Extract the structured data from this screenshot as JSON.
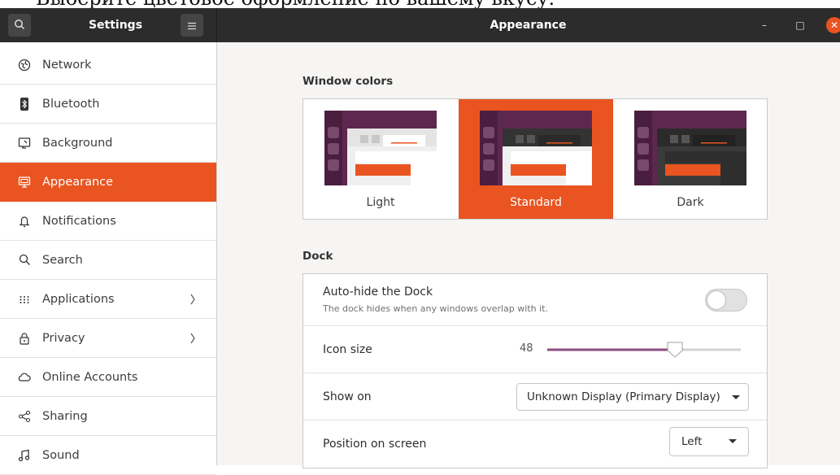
{
  "caption_text": "Выберите цветовое оформление по вашему вкусу.",
  "titlebar": {
    "app_title": "Settings",
    "page_title": "Appearance",
    "search_icon": "search-icon",
    "menu_icon": "hamburger-menu-icon",
    "minimize_label": "–",
    "maximize_label": "□",
    "close_label": "✕"
  },
  "sidebar": {
    "items": [
      {
        "label": "Network",
        "icon": "network-icon"
      },
      {
        "label": "Bluetooth",
        "icon": "bluetooth-icon"
      },
      {
        "label": "Background",
        "icon": "background-icon"
      },
      {
        "label": "Appearance",
        "icon": "appearance-icon",
        "active": true
      },
      {
        "label": "Notifications",
        "icon": "bell-icon"
      },
      {
        "label": "Search",
        "icon": "search-icon"
      },
      {
        "label": "Applications",
        "icon": "apps-grid-icon",
        "has_submenu": true
      },
      {
        "label": "Privacy",
        "icon": "lock-icon",
        "has_submenu": true
      },
      {
        "label": "Online Accounts",
        "icon": "cloud-icon"
      },
      {
        "label": "Sharing",
        "icon": "share-icon"
      },
      {
        "label": "Sound",
        "icon": "music-note-icon"
      }
    ]
  },
  "window_colors": {
    "title": "Window colors",
    "options": [
      {
        "label": "Light",
        "selected": false
      },
      {
        "label": "Standard",
        "selected": true
      },
      {
        "label": "Dark",
        "selected": false
      }
    ]
  },
  "dock": {
    "title": "Dock",
    "autohide": {
      "label": "Auto-hide the Dock",
      "sublabel": "The dock hides when any windows overlap with it.",
      "enabled": false
    },
    "icon_size": {
      "label": "Icon size",
      "value": "48",
      "level_fraction": 0.66
    },
    "show_on": {
      "label": "Show on",
      "value": "Unknown Display (Primary Display)"
    },
    "position": {
      "label": "Position on screen",
      "value": "Left"
    }
  },
  "colors": {
    "accent": "#e95420",
    "titlebar": "#2c2c2c",
    "aubergine": "#5e2750",
    "slider_fill": "#8c4c7e"
  }
}
